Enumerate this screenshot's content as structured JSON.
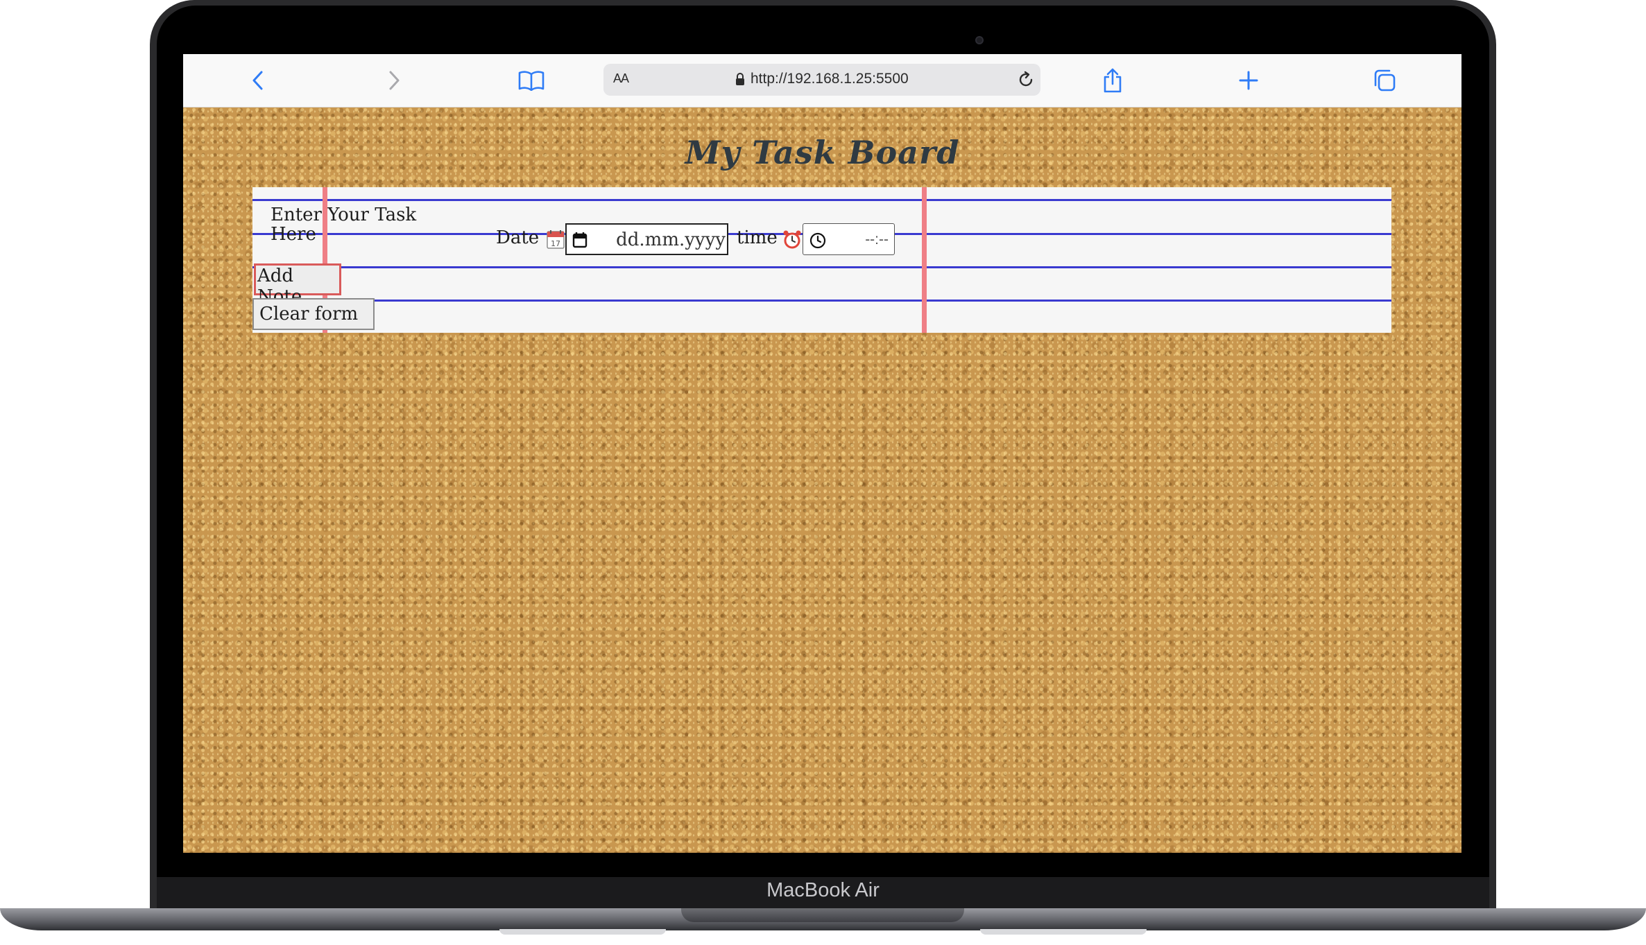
{
  "device": {
    "label": "MacBook Air"
  },
  "browser": {
    "reader_text_size_label": "AA",
    "url": "http://192.168.1.25:5500",
    "icons": {
      "back": "chevron-left-icon",
      "forward": "chevron-right-icon",
      "bookmarks": "book-icon",
      "lock": "lock-icon",
      "reload": "reload-icon",
      "share": "share-icon",
      "new_tab": "plus-icon",
      "tabs": "tabs-icon"
    },
    "accent_color": "#2f7cf6"
  },
  "page": {
    "title": "My Task Board",
    "form": {
      "task_label": "Enter Your Task Here",
      "date_label": "Date",
      "date_value": "dd.mm.yyyy",
      "time_label": "time",
      "time_value": "--:--",
      "add_button": "Add Note",
      "clear_button": "Clear form"
    },
    "colors": {
      "corkboard": "#c9974f",
      "paper": "#f6f6f6",
      "ruled_line": "#3a3ad0",
      "margin_line": "#ef7f86"
    }
  }
}
